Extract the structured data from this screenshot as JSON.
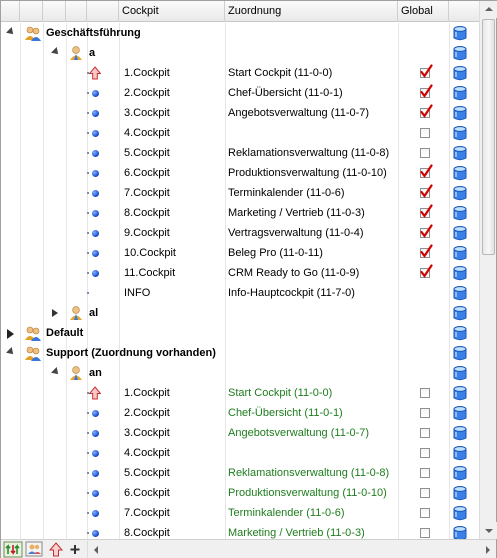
{
  "columns": {
    "cockpit": "Cockpit",
    "zuordnung": "Zuordnung",
    "global": "Global"
  },
  "groups": [
    {
      "name": "Geschäftsführung",
      "expanded": true,
      "users": [
        {
          "name": "a",
          "expanded": true,
          "items": [
            {
              "cockpit": "1.Cockpit",
              "assignment": "Start Cockpit (11-0-0)",
              "global": true,
              "marker": "up-arrow"
            },
            {
              "cockpit": "2.Cockpit",
              "assignment": "Chef-Übersicht (11-0-1)",
              "global": true,
              "marker": "bullet"
            },
            {
              "cockpit": "3.Cockpit",
              "assignment": "Angebotsverwaltung (11-0-7)",
              "global": true,
              "marker": "bullet"
            },
            {
              "cockpit": "4.Cockpit",
              "assignment": "",
              "global": false,
              "marker": "bullet"
            },
            {
              "cockpit": "5.Cockpit",
              "assignment": "Reklamationsverwaltung (11-0-8)",
              "global": false,
              "marker": "bullet"
            },
            {
              "cockpit": "6.Cockpit",
              "assignment": "Produktionsverwaltung (11-0-10)",
              "global": true,
              "marker": "bullet"
            },
            {
              "cockpit": "7.Cockpit",
              "assignment": "Terminkalender (11-0-6)",
              "global": true,
              "marker": "bullet"
            },
            {
              "cockpit": "8.Cockpit",
              "assignment": "Marketing / Vertrieb (11-0-3)",
              "global": true,
              "marker": "bullet"
            },
            {
              "cockpit": "9.Cockpit",
              "assignment": "Vertragsverwaltung (11-0-4)",
              "global": true,
              "marker": "bullet"
            },
            {
              "cockpit": "10.Cockpit",
              "assignment": "Beleg Pro (11-0-11)",
              "global": true,
              "marker": "bullet"
            },
            {
              "cockpit": "11.Cockpit",
              "assignment": "CRM Ready to Go (11-0-9)",
              "global": true,
              "marker": "bullet"
            },
            {
              "cockpit": "INFO",
              "assignment": "Info-Hauptcockpit (11-7-0)",
              "global": null,
              "marker": "dot"
            }
          ]
        },
        {
          "name": "al",
          "expanded": false,
          "items": []
        }
      ]
    },
    {
      "name": "Default",
      "expanded": false,
      "users": []
    },
    {
      "name": "Support (Zuordnung vorhanden)",
      "expanded": true,
      "users": [
        {
          "name": "an",
          "expanded": true,
          "items": [
            {
              "cockpit": "1.Cockpit",
              "assignment": "Start Cockpit (11-0-0)",
              "global": false,
              "marker": "up-arrow"
            },
            {
              "cockpit": "2.Cockpit",
              "assignment": "Chef-Übersicht (11-0-1)",
              "global": false,
              "marker": "bullet"
            },
            {
              "cockpit": "3.Cockpit",
              "assignment": "Angebotsverwaltung (11-0-7)",
              "global": false,
              "marker": "bullet"
            },
            {
              "cockpit": "4.Cockpit",
              "assignment": "",
              "global": false,
              "marker": "bullet"
            },
            {
              "cockpit": "5.Cockpit",
              "assignment": "Reklamationsverwaltung (11-0-8)",
              "global": false,
              "marker": "bullet"
            },
            {
              "cockpit": "6.Cockpit",
              "assignment": "Produktionsverwaltung (11-0-10)",
              "global": false,
              "marker": "bullet"
            },
            {
              "cockpit": "7.Cockpit",
              "assignment": "Terminkalender (11-0-6)",
              "global": false,
              "marker": "bullet"
            },
            {
              "cockpit": "8.Cockpit",
              "assignment": "Marketing / Vertrieb (11-0-3)",
              "global": false,
              "marker": "bullet"
            }
          ]
        }
      ]
    }
  ],
  "colors": {
    "assignment_green": "#1e7d1e",
    "check_red": "#d10000",
    "bullet_blue": "#1545c8",
    "db_blue": "#2a6fd6"
  },
  "icons": {
    "group": "users-group-icon",
    "user": "user-icon",
    "database": "database-icon",
    "up_arrow": "up-arrow-icon",
    "check": "checkmark-icon"
  },
  "toolbar": {
    "buttons": [
      "up-down-arrows-icon",
      "users-group-icon",
      "up-arrow-icon",
      "plus-icon"
    ]
  }
}
